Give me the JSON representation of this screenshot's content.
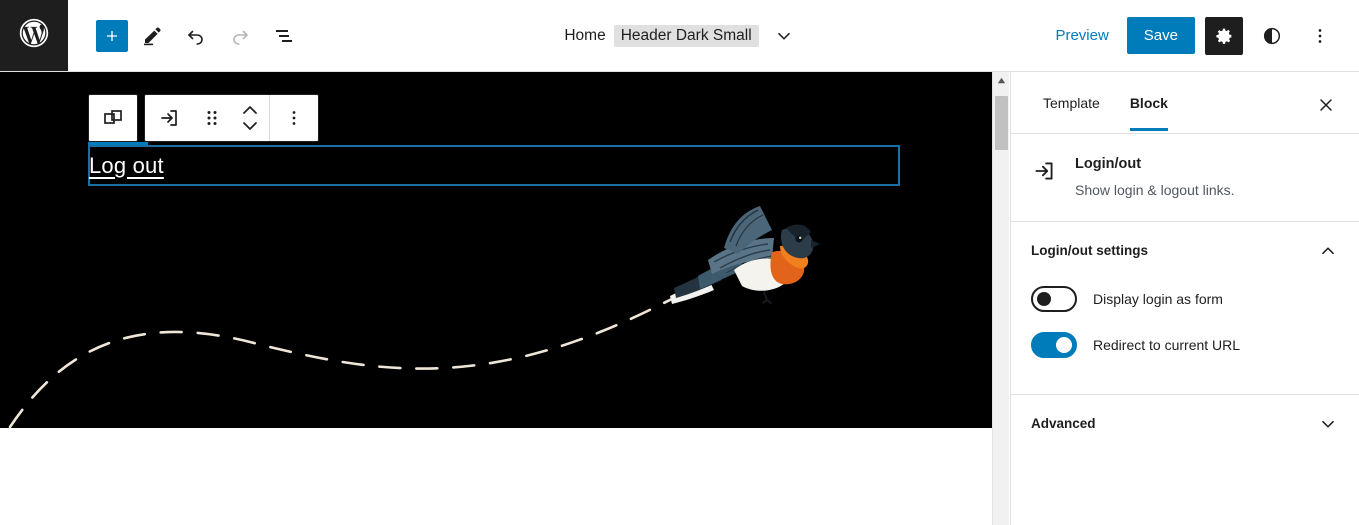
{
  "header": {
    "logo_icon": "wordpress-logo-icon",
    "tools": [
      {
        "name": "add-block-button",
        "icon": "plus-icon",
        "label": "Add block",
        "state": "primary"
      },
      {
        "name": "edit-tool-button",
        "icon": "pencil-icon",
        "label": "Tools",
        "state": "default"
      },
      {
        "name": "undo-button",
        "icon": "undo-arrow-icon",
        "label": "Undo",
        "state": "default"
      },
      {
        "name": "redo-button",
        "icon": "redo-arrow-icon",
        "label": "Redo",
        "state": "disabled"
      },
      {
        "name": "list-view-button",
        "icon": "list-view-icon",
        "label": "List View",
        "state": "default"
      }
    ],
    "document_bar": {
      "home_label": "Home",
      "template_name": "Header Dark Small",
      "chevron_icon": "chevron-down-icon"
    },
    "preview_label": "Preview",
    "save_label": "Save",
    "settings_icon": "gear-icon",
    "styles_icon": "contrast-half-circle-icon",
    "options_icon": "three-dots-vertical-icon"
  },
  "canvas": {
    "block_toolbar": {
      "parent_block_icon": "select-parent-block-icon",
      "block_type_icon": "login-arrow-icon",
      "drag_handle_icon": "six-dots-drag-icon",
      "move_up_icon": "chevron-up-icon",
      "move_down_icon": "chevron-down-icon",
      "options_icon": "three-dots-vertical-icon"
    },
    "selected_block_text": "Log out",
    "bird_image_alt": "flying-bird-illustration",
    "dashed_path_alt": "dashed-flight-path"
  },
  "scrollbar": {
    "up_arrow_icon": "scroll-up-arrow-icon"
  },
  "sidebar": {
    "tabs": [
      {
        "label": "Template",
        "active": false
      },
      {
        "label": "Block",
        "active": true
      }
    ],
    "close_icon": "close-x-icon",
    "block_card": {
      "icon": "login-arrow-icon",
      "title": "Login/out",
      "description": "Show login & logout links."
    },
    "settings_section": {
      "title": "Login/out settings",
      "chevron_icon": "chevron-up-icon",
      "toggles": [
        {
          "label": "Display login as form",
          "on": false
        },
        {
          "label": "Redirect to current URL",
          "on": true
        }
      ]
    },
    "advanced_section": {
      "title": "Advanced",
      "chevron_icon": "chevron-down-icon"
    }
  },
  "colors": {
    "accent": "#007cba",
    "dark": "#1e1e1e",
    "canvas_bg": "#000000",
    "selection_border": "#1a6fa3",
    "dash_stroke": "#efe6d8"
  }
}
